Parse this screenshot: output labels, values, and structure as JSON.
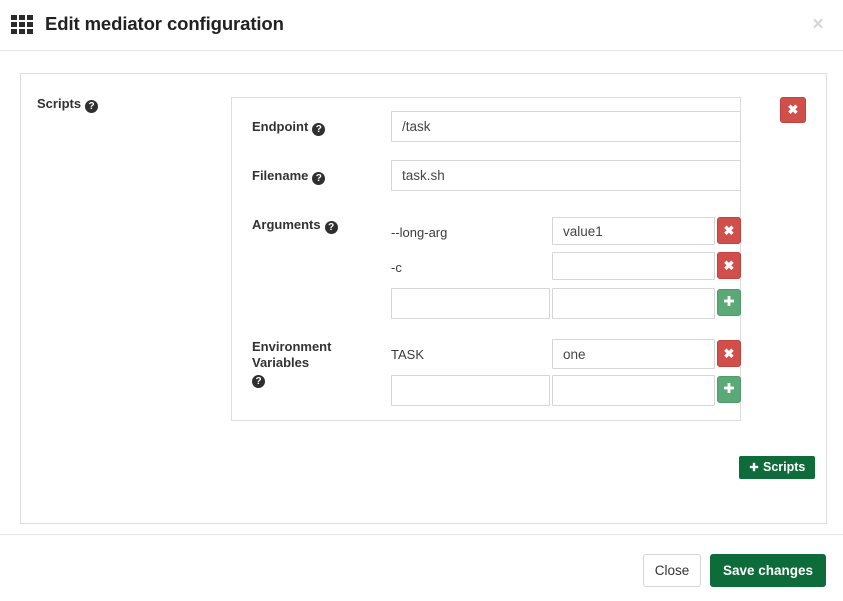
{
  "header": {
    "title": "Edit mediator configuration",
    "grid_icon": "apps-grid-icon",
    "close_icon": "×"
  },
  "body": {
    "section": {
      "label": "Scripts",
      "help_icon": "?",
      "delete_icon": "✖"
    },
    "fields": [
      {
        "label": "Endpoint",
        "help_icon": "?",
        "value": "/task",
        "placeholder": ""
      },
      {
        "label": "Filename",
        "help_icon": "?",
        "value": "task.sh",
        "placeholder": ""
      }
    ],
    "arguments": {
      "label": "Arguments",
      "help_icon": "?",
      "rows": [
        {
          "key": "--long-arg",
          "value": "value1",
          "action_icon": "✖",
          "action": "remove"
        },
        {
          "key": "-c",
          "value": "",
          "action_icon": "✖",
          "action": "remove"
        }
      ],
      "new_row": {
        "key": "",
        "value": "",
        "action_icon": "➕",
        "action": "add"
      }
    },
    "environment_variables": {
      "label_line1": "Environment",
      "label_line2": "Variables",
      "help_icon": "?",
      "rows": [
        {
          "key": "TASK",
          "value": "one",
          "action_icon": "✖",
          "action": "remove"
        }
      ],
      "new_row": {
        "key": "",
        "value": "",
        "action_icon": "➕",
        "action": "add"
      }
    },
    "add_scripts_button": {
      "icon": "➕",
      "label": "Scripts"
    }
  },
  "footer": {
    "close_label": "Close",
    "save_label": "Save changes"
  },
  "colors": {
    "brand_green": "#0d6c3a",
    "add_green": "#5aa977",
    "delete_red": "#d14f4a",
    "border_gray": "#dddddd",
    "input_border": "#d6d6d6"
  }
}
